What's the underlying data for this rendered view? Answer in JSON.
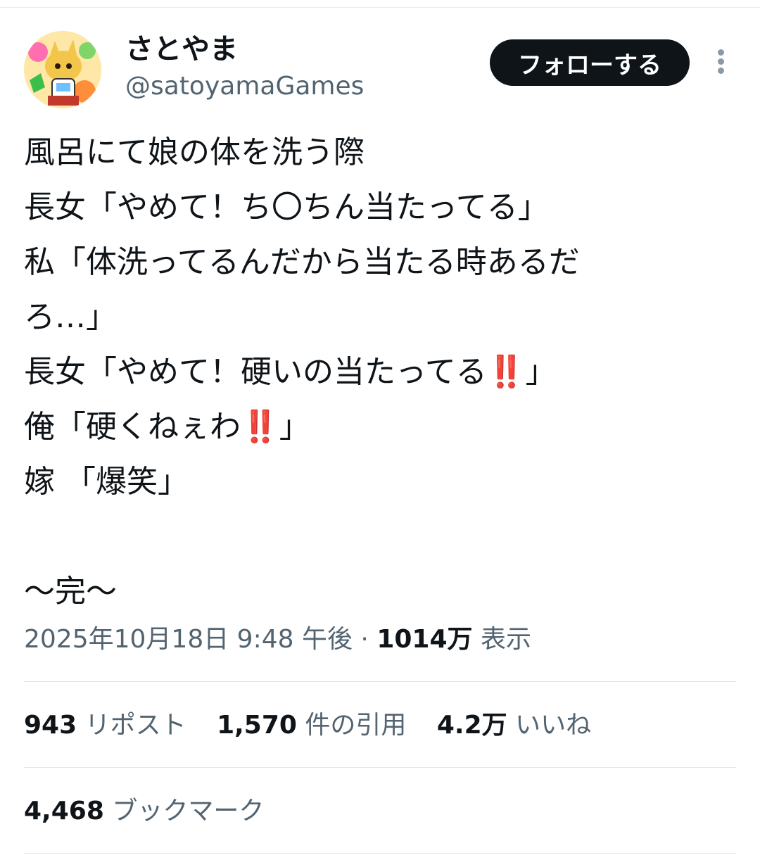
{
  "user": {
    "display_name": "さとやま",
    "handle": "@satoyamaGames"
  },
  "follow_button": {
    "label": "フォローする"
  },
  "more_icon": "more-vertical-icon",
  "tweet": {
    "lines": [
      "風呂にて娘の体を洗う際",
      "長女「やめて！ち〇ちん当たってる」",
      "私「体洗ってるんだから当たる時あるだ",
      "ろ…」",
      "長女「やめて！硬いの当たってる‼️」",
      "俺「硬くねぇわ‼️」",
      "嫁 「爆笑」",
      "",
      "～完～"
    ]
  },
  "meta": {
    "timestamp": "2025年10月18日 9:48 午後",
    "separator": "·",
    "views_count": "1014万",
    "views_label": "表示"
  },
  "stats": {
    "reposts": {
      "count": "943",
      "label": "リポスト"
    },
    "quotes": {
      "count": "1,570",
      "label": "件の引用"
    },
    "likes": {
      "count": "4.2万",
      "label": "いいね"
    },
    "bookmarks": {
      "count": "4,468",
      "label": "ブックマーク"
    }
  }
}
